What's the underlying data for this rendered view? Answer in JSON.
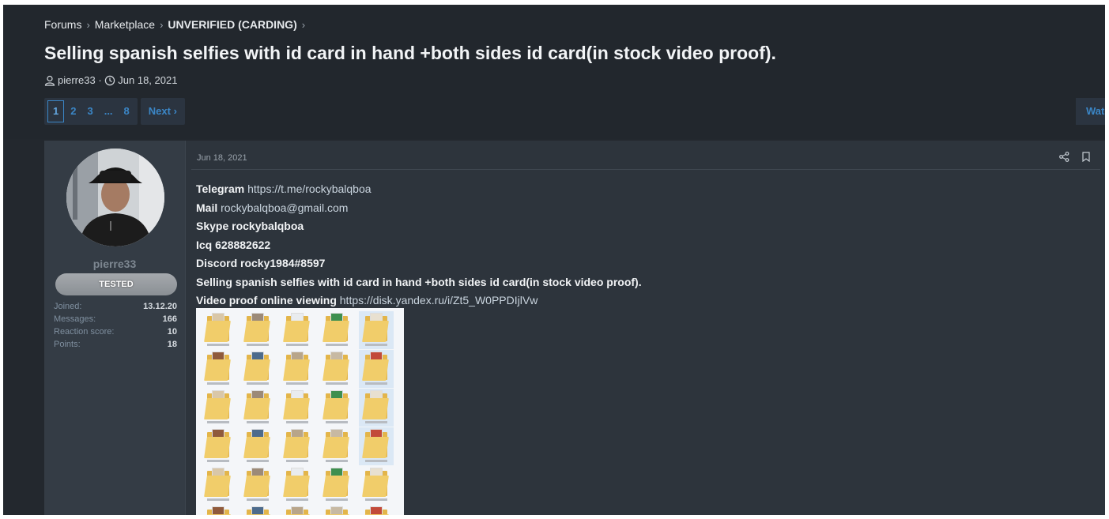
{
  "breadcrumb": {
    "items": [
      "Forums",
      "Marketplace",
      "UNVERIFIED (CARDING)"
    ],
    "separator": "›"
  },
  "thread": {
    "title": "Selling spanish selfies with id card in hand +both sides id card(in stock video proof).",
    "author": "pierre33",
    "date": "Jun 18, 2021"
  },
  "pagination": {
    "pages": [
      "1",
      "2",
      "3",
      "...",
      "8"
    ],
    "active": "1",
    "next_label": "Next ›",
    "watch_label": "Watch"
  },
  "user": {
    "name": "pierre33",
    "badge": "TESTED",
    "stats": [
      {
        "label": "Joined:",
        "value": "13.12.20"
      },
      {
        "label": "Messages:",
        "value": "166"
      },
      {
        "label": "Reaction score:",
        "value": "10"
      },
      {
        "label": "Points:",
        "value": "18"
      }
    ]
  },
  "post": {
    "date": "Jun 18, 2021",
    "telegram_label": "Telegram",
    "telegram_url": "https://t.me/rockybalqboa",
    "mail_label": "Mail",
    "mail_value": "rockybalqboa@gmail.com",
    "skype_label": "Skype",
    "skype_value": "rockybalqboa",
    "icq_label": "Icq",
    "icq_value": "628882622",
    "discord_label": "Discord",
    "discord_value": "rocky1984#8597",
    "description": "Selling spanish selfies with id card in hand +both sides id card(in stock video proof).",
    "video_label": "Video proof online viewing",
    "video_url": "https://disk.yandex.ru/i/Zt5_W0PPDIjlVw"
  },
  "colors": {
    "background": "#23282e",
    "post_background": "#2d343c",
    "link": "#3b86c6",
    "folder": "#f1cd6a"
  },
  "icons": [
    "user-icon",
    "clock-icon",
    "share-icon",
    "bookmark-icon",
    "folder-icon"
  ]
}
